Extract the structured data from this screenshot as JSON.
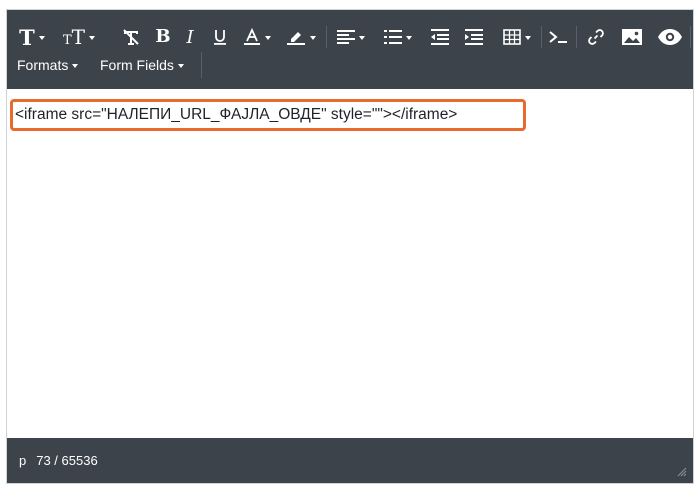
{
  "toolbar": {
    "formats_label": "Formats",
    "form_fields_label": "Form Fields",
    "icons": [
      "font-family-icon",
      "font-size-icon",
      "clear-formatting-icon",
      "bold-icon",
      "italic-icon",
      "underline-icon",
      "text-color-icon",
      "highlight-color-icon",
      "align-icon",
      "list-icon",
      "outdent-icon",
      "indent-icon",
      "table-icon",
      "code-icon",
      "link-icon",
      "image-icon",
      "preview-eye-icon"
    ]
  },
  "content": {
    "code_text": "<iframe src=\"НАЛЕПИ_URL_ФАЈЛА_ОВДЕ\" style=\"\"></iframe>"
  },
  "status": {
    "path": "p",
    "char_count": "73 / 65536"
  },
  "colors": {
    "toolbar_bg": "#3c434b",
    "highlight_border": "#e86b2e"
  }
}
